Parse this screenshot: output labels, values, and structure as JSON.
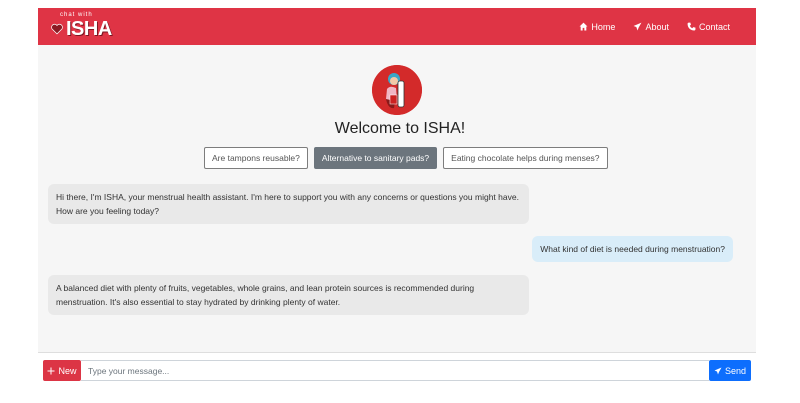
{
  "brand": {
    "small_text": "chat with",
    "name": "ISHA"
  },
  "nav": {
    "items": [
      {
        "label": "Home",
        "icon": "home-icon"
      },
      {
        "label": "About",
        "icon": "paper-plane-icon"
      },
      {
        "label": "Contact",
        "icon": "phone-icon"
      }
    ]
  },
  "welcome": {
    "title": "Welcome to ISHA!"
  },
  "suggestions": [
    {
      "label": "Are tampons reusable?"
    },
    {
      "label": "Alternative to sanitary pads?",
      "active": true
    },
    {
      "label": "Eating chocolate helps during menses?"
    }
  ],
  "messages": [
    {
      "role": "bot",
      "text": "Hi there, I'm ISHA, your menstrual health assistant. I'm here to support you with any concerns or questions you might have. How are you feeling today?"
    },
    {
      "role": "user",
      "text": "What kind of diet is needed during menstruation?"
    },
    {
      "role": "bot",
      "text": "A balanced diet with plenty of fruits, vegetables, whole grains, and lean protein sources is recommended during menstruation. It's also essential to stay hydrated by drinking plenty of water."
    }
  ],
  "composer": {
    "new_label": "New",
    "placeholder": "Type your message...",
    "value": "",
    "send_label": "Send"
  },
  "colors": {
    "navbar": "#df3445",
    "new_button": "#dc3545",
    "send_button": "#0d6efd",
    "user_bubble": "#d9edf9",
    "bot_bubble": "#e9e9e9"
  }
}
